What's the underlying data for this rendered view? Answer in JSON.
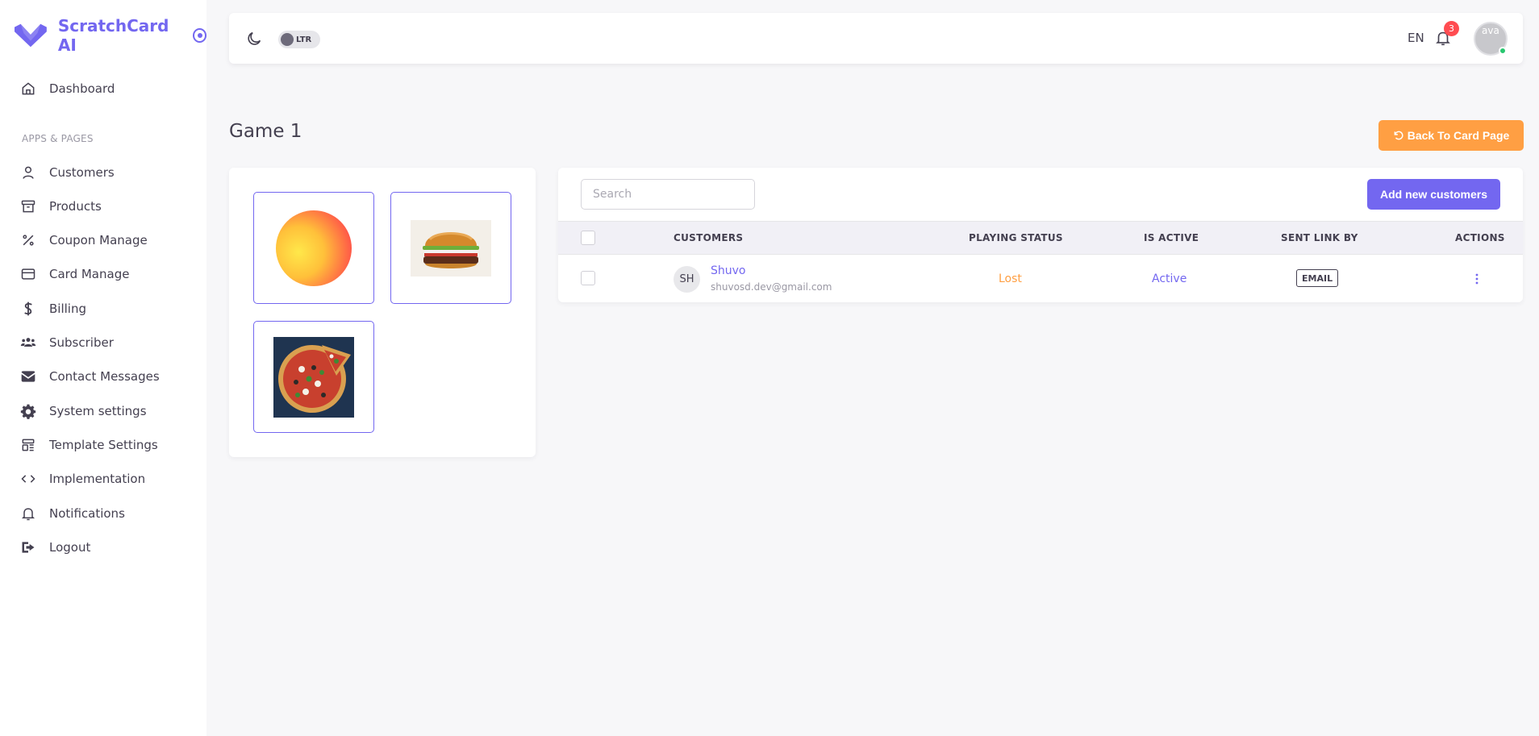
{
  "brand": {
    "name": "ScratchCard AI",
    "color": "#7367f0"
  },
  "sidebar": {
    "section_label": "APPS & PAGES",
    "items": [
      {
        "label": "Dashboard",
        "icon": "home-icon"
      },
      {
        "label": "Customers",
        "icon": "user-icon"
      },
      {
        "label": "Products",
        "icon": "archive-icon"
      },
      {
        "label": "Coupon Manage",
        "icon": "percent-icon"
      },
      {
        "label": "Card Manage",
        "icon": "credit-card-icon"
      },
      {
        "label": "Billing",
        "icon": "dollar-icon"
      },
      {
        "label": "Subscriber",
        "icon": "users-icon"
      },
      {
        "label": "Contact Messages",
        "icon": "envelope-icon"
      },
      {
        "label": "System settings",
        "icon": "gear-icon"
      },
      {
        "label": "Template Settings",
        "icon": "layout-icon"
      },
      {
        "label": "Implementation",
        "icon": "code-icon"
      },
      {
        "label": "Notifications",
        "icon": "bell-icon"
      },
      {
        "label": "Logout",
        "icon": "logout-icon"
      }
    ]
  },
  "topbar": {
    "direction_toggle": "LTR",
    "language": "EN",
    "notification_count": "3",
    "avatar_alt": "ava"
  },
  "page": {
    "title": "Game 1",
    "back_button": "Back To Card Page"
  },
  "gallery": {
    "items": [
      {
        "name": "peach"
      },
      {
        "name": "burger"
      },
      {
        "name": "pizza"
      }
    ]
  },
  "table": {
    "search_placeholder": "Search",
    "add_button": "Add new customers",
    "columns": [
      "CUSTOMERS",
      "PLAYING STATUS",
      "IS ACTIVE",
      "SENT LINK BY",
      "ACTIONS"
    ],
    "rows": [
      {
        "initials": "SH",
        "name": "Shuvo",
        "email": "shuvosd.dev@gmail.com",
        "playing_status": "Lost",
        "is_active": "Active",
        "sent_link_by": "EMAIL"
      }
    ]
  },
  "colors": {
    "primary": "#7367f0",
    "warning": "#ff9f43",
    "danger": "#ff4c51",
    "success": "#28c76f"
  }
}
